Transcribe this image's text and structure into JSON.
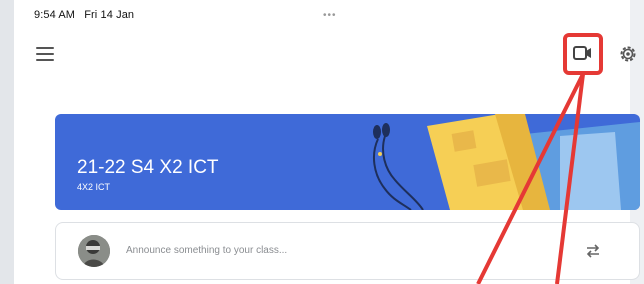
{
  "status_bar": {
    "time": "9:54 AM",
    "date": "Fri 14 Jan"
  },
  "header": {
    "menu_icon": "hamburger-menu-icon",
    "meet_icon": "video-camera-icon",
    "settings_icon": "gear-icon",
    "highlight_color": "#e53935"
  },
  "banner": {
    "title": "21-22 S4 X2 ICT",
    "section": "4X2 ICT",
    "background": "#3f6ad8"
  },
  "stream": {
    "announce_placeholder": "Announce something to your class...",
    "repost_icon": "repost-arrows-icon"
  }
}
